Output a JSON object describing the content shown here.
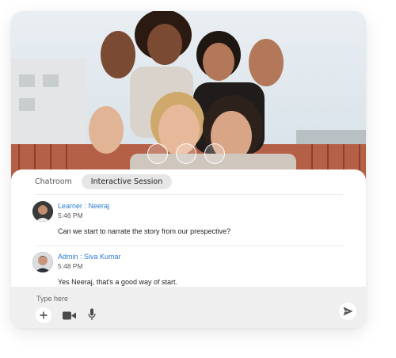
{
  "photo": {
    "description_icon": "group-selfie-image",
    "carousel_dots": 3
  },
  "tabs": [
    {
      "label": "Chatroom",
      "active": false
    },
    {
      "label": "Interactive Session",
      "active": true
    }
  ],
  "messages": [
    {
      "author": "Learner : Neeraj",
      "time": "5:46 PM",
      "text": "Can we start to narrate the story from our prespective?"
    },
    {
      "author": " Admin : Siva Kumar",
      "time": "5:48 PM",
      "text": "Yes Neeraj, that's  a good way of start."
    }
  ],
  "composer": {
    "placeholder": "Type here",
    "icons": [
      "plus-icon",
      "video-camera-icon",
      "microphone-icon",
      "send-icon"
    ]
  },
  "colors": {
    "author": "#2a79d6",
    "active_tab": "#e6e6e6",
    "composer_bg": "#efefef"
  }
}
